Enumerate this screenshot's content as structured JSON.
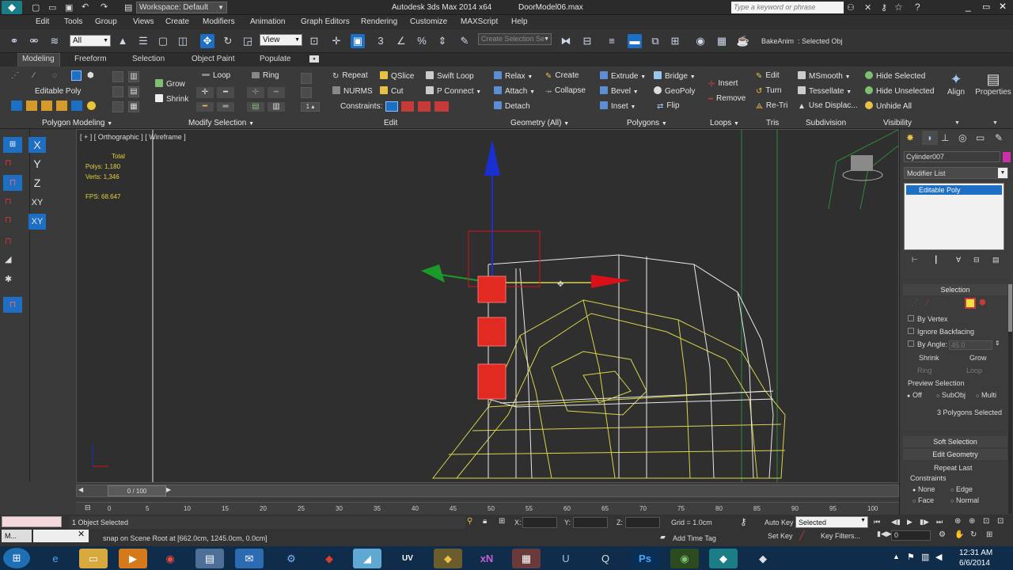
{
  "title_bar": {
    "workspace": "Workspace: Default",
    "app_title": "Autodesk 3ds Max  2014 x64",
    "file_name": "DoorModel06.max",
    "search_placeholder": "Type a keyword or phrase"
  },
  "menu": [
    "Edit",
    "Tools",
    "Group",
    "Views",
    "Create",
    "Modifiers",
    "Animation",
    "Graph Editors",
    "Rendering",
    "Customize",
    "MAXScript",
    "Help"
  ],
  "main_toolbar": {
    "filter": "All",
    "ref_coord": "View",
    "selection_set_placeholder": "Create Selection Se",
    "bake_anim": "BakeAnim",
    "selected_obj": ": Selected Obj"
  },
  "ribbon_tabs": [
    "Modeling",
    "Freeform",
    "Selection",
    "Object Paint",
    "Populate"
  ],
  "ribbon": {
    "editable_poly": "Editable Poly",
    "polygon_modeling": "Polygon Modeling",
    "modify_selection": "Modify Selection",
    "edit": "Edit",
    "geometry": "Geometry (All)",
    "polygons": "Polygons",
    "loops": "Loops",
    "tris": "Tris",
    "subdivision": "Subdivision",
    "visibility": "Visibility",
    "grow": "Grow",
    "shrink": "Shrink",
    "loop": "Loop",
    "ring": "Ring",
    "repeat": "Repeat",
    "qslice": "QSlice",
    "swift_loop": "Swift Loop",
    "nurms": "NURMS",
    "cut": "Cut",
    "p_connect": "P Connect",
    "constraints": "Constraints:",
    "relax": "Relax",
    "create": "Create",
    "attach": "Attach",
    "collapse": "Collapse",
    "detach": "Detach",
    "extrude": "Extrude",
    "bridge": "Bridge",
    "bevel": "Bevel",
    "geopoly": "GeoPoly",
    "inset": "Inset",
    "flip": "Flip",
    "insert": "Insert",
    "remove": "Remove",
    "edit_tri": "Edit",
    "turn": "Turn",
    "retri": "Re-Tri",
    "msmooth": "MSmooth",
    "tessellate": "Tessellate",
    "use_displac": "Use Displac...",
    "hide_selected": "Hide Selected",
    "hide_unselected": "Hide Unselected",
    "unhide_all": "Unhide All",
    "align": "Align",
    "properties": "Properties"
  },
  "axis_buttons": [
    "X",
    "Y",
    "Z",
    "XY",
    "XY"
  ],
  "viewport": {
    "label": "[ + ] [ Orthographic ] [ Wireframe ]",
    "stats_total": "Total",
    "polys": "Polys:  1,180",
    "verts": "Verts:  1,346",
    "fps": "FPS:    68.647"
  },
  "command_panel": {
    "object_name": "Cylinder007",
    "modifier_list": "Modifier List",
    "stack_item": "Editable Poly",
    "selection_header": "Selection",
    "by_vertex": "By Vertex",
    "ignore_backfacing": "Ignore Backfacing",
    "by_angle": "By Angle:",
    "angle_value": "45.0",
    "shrink": "Shrink",
    "grow": "Grow",
    "ring": "Ring",
    "loop": "Loop",
    "preview_selection": "Preview Selection",
    "off": "Off",
    "subobj": "SubObj",
    "multi": "Multi",
    "selected_count": "3 Polygons Selected",
    "soft_selection": "Soft Selection",
    "edit_geometry": "Edit Geometry",
    "repeat_last": "Repeat Last",
    "constraints": "Constraints",
    "none": "None",
    "edge": "Edge",
    "face": "Face",
    "normal": "Normal"
  },
  "timeline": {
    "frame": "0 / 100",
    "ticks": [
      "0",
      "5",
      "10",
      "15",
      "20",
      "25",
      "30",
      "35",
      "40",
      "45",
      "50",
      "55",
      "60",
      "65",
      "70",
      "75",
      "80",
      "85",
      "90",
      "95",
      "100"
    ]
  },
  "status": {
    "selected": "1 Object Selected",
    "prompt": "snap on Scene Root at [662.0cm, 1245.0cm, 0.0cm]",
    "grid": "Grid = 1.0cm",
    "add_time_tag": "Add Time Tag",
    "auto_key": "Auto Key",
    "set_key": "Set Key",
    "key_mode": "Selected",
    "key_filters": "Key Filters...",
    "frame_field": "0",
    "x_label": "X:",
    "y_label": "Y:",
    "z_label": "Z:",
    "maxscript_label": "M..."
  },
  "taskbar": {
    "time": "12:31 AM",
    "date": "6/6/2014",
    "apps": [
      "ie",
      "explorer",
      "media",
      "chrome",
      "files",
      "outlook",
      "network",
      "flash",
      "ruby",
      "uv",
      "3ds",
      "xn",
      "archive",
      "unreal",
      "qt",
      "photoshop",
      "nvidia",
      "max",
      "max2"
    ]
  },
  "colors": {
    "accent_blue": "#1c6fc2",
    "selected_red": "#e02a22",
    "wire_white": "#e8e8e8",
    "wire_yellow": "#d9d44a",
    "stats_yellow": "#e3d33b",
    "axis_blue": "#1a2fd0",
    "axis_red": "#d8101a",
    "axis_green": "#1a9a2a"
  }
}
